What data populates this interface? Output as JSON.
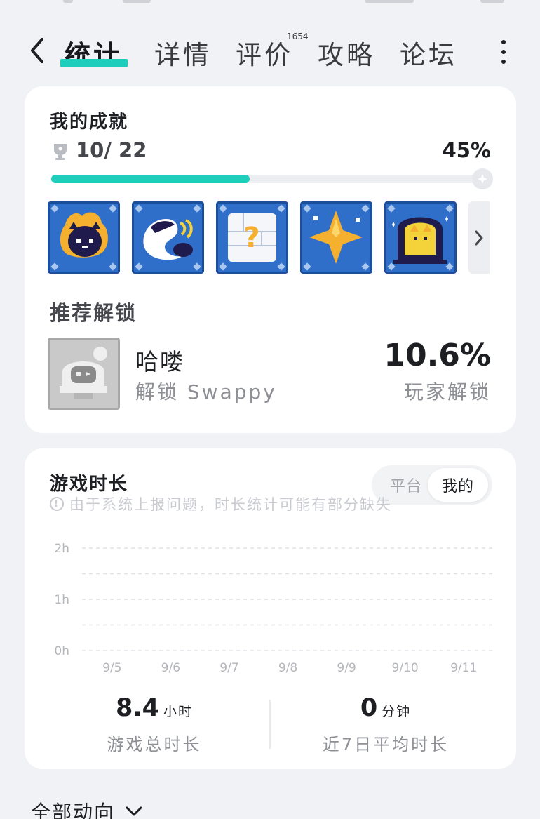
{
  "nav": {
    "tabs": [
      {
        "label": "统计",
        "active": true
      },
      {
        "label": "详情",
        "active": false
      },
      {
        "label": "评价",
        "active": false,
        "badge": "1654"
      },
      {
        "label": "攻略",
        "active": false
      },
      {
        "label": "论坛",
        "active": false
      }
    ],
    "accent": "#1ecdbc"
  },
  "achievements": {
    "title": "我的成就",
    "count": "10/ 22",
    "percent_label": "45%",
    "progress_fraction": 0.45,
    "icons": [
      "cat-fire-icon",
      "cat-sleep-icon",
      "question-block-icon",
      "star-sparkle-icon",
      "cat-portal-icon"
    ]
  },
  "recommend": {
    "title": "推荐解锁",
    "name": "哈喽",
    "desc": "解锁 Swappy",
    "rate": "10.6%",
    "rate_label": "玩家解锁"
  },
  "playtime": {
    "title": "游戏时长",
    "toggle": {
      "platform": "平台",
      "mine": "我的",
      "selected": "mine"
    },
    "notice": "由于系统上报问题，时长统计可能有部分缺失",
    "total_value": "8.4",
    "total_unit": "小时",
    "total_label": "游戏总时长",
    "avg_value": "0",
    "avg_unit": "分钟",
    "avg_label": "近7日平均时长"
  },
  "chart_data": {
    "type": "bar",
    "categories": [
      "9/5",
      "9/6",
      "9/7",
      "9/8",
      "9/9",
      "9/10",
      "9/11"
    ],
    "values": [
      0,
      0,
      0,
      0,
      0,
      0,
      0
    ],
    "y_ticks": [
      "0h",
      "1h",
      "2h"
    ],
    "ylim": [
      0,
      2
    ],
    "grid": true
  },
  "footer": {
    "label": "全部动向"
  }
}
